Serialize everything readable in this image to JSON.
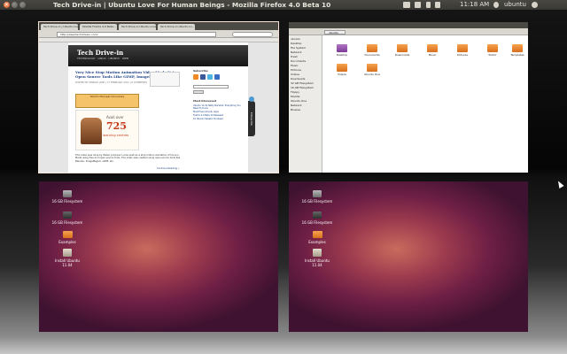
{
  "panel": {
    "title": "Tech Drive-in | Ubuntu Love For Human Beings - Mozilla Firefox 4.0 Beta 10",
    "clock": "11:18 AM",
    "user": "ubuntu",
    "colors": {
      "panel_bg": "#3c3b37",
      "close_button": "#e05a24"
    }
  },
  "workspaces": {
    "top_left": {
      "firefox": {
        "tabs": [
          "Tech Drive-in | Ubuntu Love...",
          "Mozilla Firefox 4.0 Beta...",
          "Tech Drive-in Ubuntu Love",
          "Tech Drive-in Ubuntu Lo..."
        ],
        "url": "http://www.techdrivein.com/",
        "page": {
          "site_title": "Tech Drive-in",
          "tagline": "TECHNOLOGY · LINUX · UBUNTU · WEB",
          "post_title": "Very Nice Stop Motion Animation Video Made Using Open Source Tools Like GIMP, ImageMagick",
          "post_meta": "POSTED BY MANUEL JOSE | 17 FEBRUARY 2011 | 8 COMMENTS",
          "ad_text": "Sikkim Manipal University",
          "ad2_label": "Avail over",
          "ad2_number": "725",
          "ad2_sub": "learning centres",
          "post_text": "This video was done by Italian producer Lucas Leidi as a stop motion animation of his son. Made using free and open source tools. The video was created using open source tools like Blender, ImageMagick, GIMP, etc.",
          "continue_label": "Continue Reading »",
          "sidebar_subscribe": "Subscribe",
          "sidebar_search": "Search",
          "sidebar_most_discussed": "Most Discussed",
          "sidebar_links": [
            "Ubuntu 11.04 Natty Narwhal: Everything You Need To Know",
            "Must Have Ubuntu Apps",
            "Firefox 4.0 Beta 10 Released",
            "10 Ubuntu Tweaks You Need"
          ],
          "follow_label": "Follow Me"
        }
      }
    },
    "top_right": {
      "nautilus": {
        "location": "ubuntu",
        "places": [
          "ubuntu",
          "Desktop",
          "File System",
          "Network",
          "Trash",
          "Documents",
          "Music",
          "Pictures",
          "Videos",
          "Downloads",
          "32 GB Filesystem",
          "16 GB Filesystem",
          "Floppy",
          "Mozilla",
          "Ubuntu One",
          "Network",
          "Browse"
        ],
        "files": [
          {
            "name": "Desktop",
            "color": "purple"
          },
          {
            "name": "Documents",
            "color": "orange"
          },
          {
            "name": "Downloads",
            "color": "orange"
          },
          {
            "name": "Music",
            "color": "orange"
          },
          {
            "name": "Pictures",
            "color": "orange"
          },
          {
            "name": "Public",
            "color": "orange"
          },
          {
            "name": "Templates",
            "color": "orange"
          },
          {
            "name": "Videos",
            "color": "orange"
          },
          {
            "name": "Ubuntu One",
            "color": "orange"
          }
        ]
      }
    },
    "bottom_left": {
      "desktop_icons": [
        {
          "label": "16 GB Filesystem",
          "type": "drive"
        },
        {
          "label": "16 GB Filesystem",
          "type": "drive-dark"
        },
        {
          "label": "Examples",
          "type": "folder"
        },
        {
          "label": "Install Ubuntu 11.04",
          "type": "archive"
        }
      ]
    },
    "bottom_right": {
      "desktop_icons": [
        {
          "label": "16 GB Filesystem",
          "type": "drive"
        },
        {
          "label": "16 GB Filesystem",
          "type": "drive-dark"
        },
        {
          "label": "Examples",
          "type": "folder"
        },
        {
          "label": "Install Ubuntu 11.04",
          "type": "archive"
        }
      ]
    }
  }
}
